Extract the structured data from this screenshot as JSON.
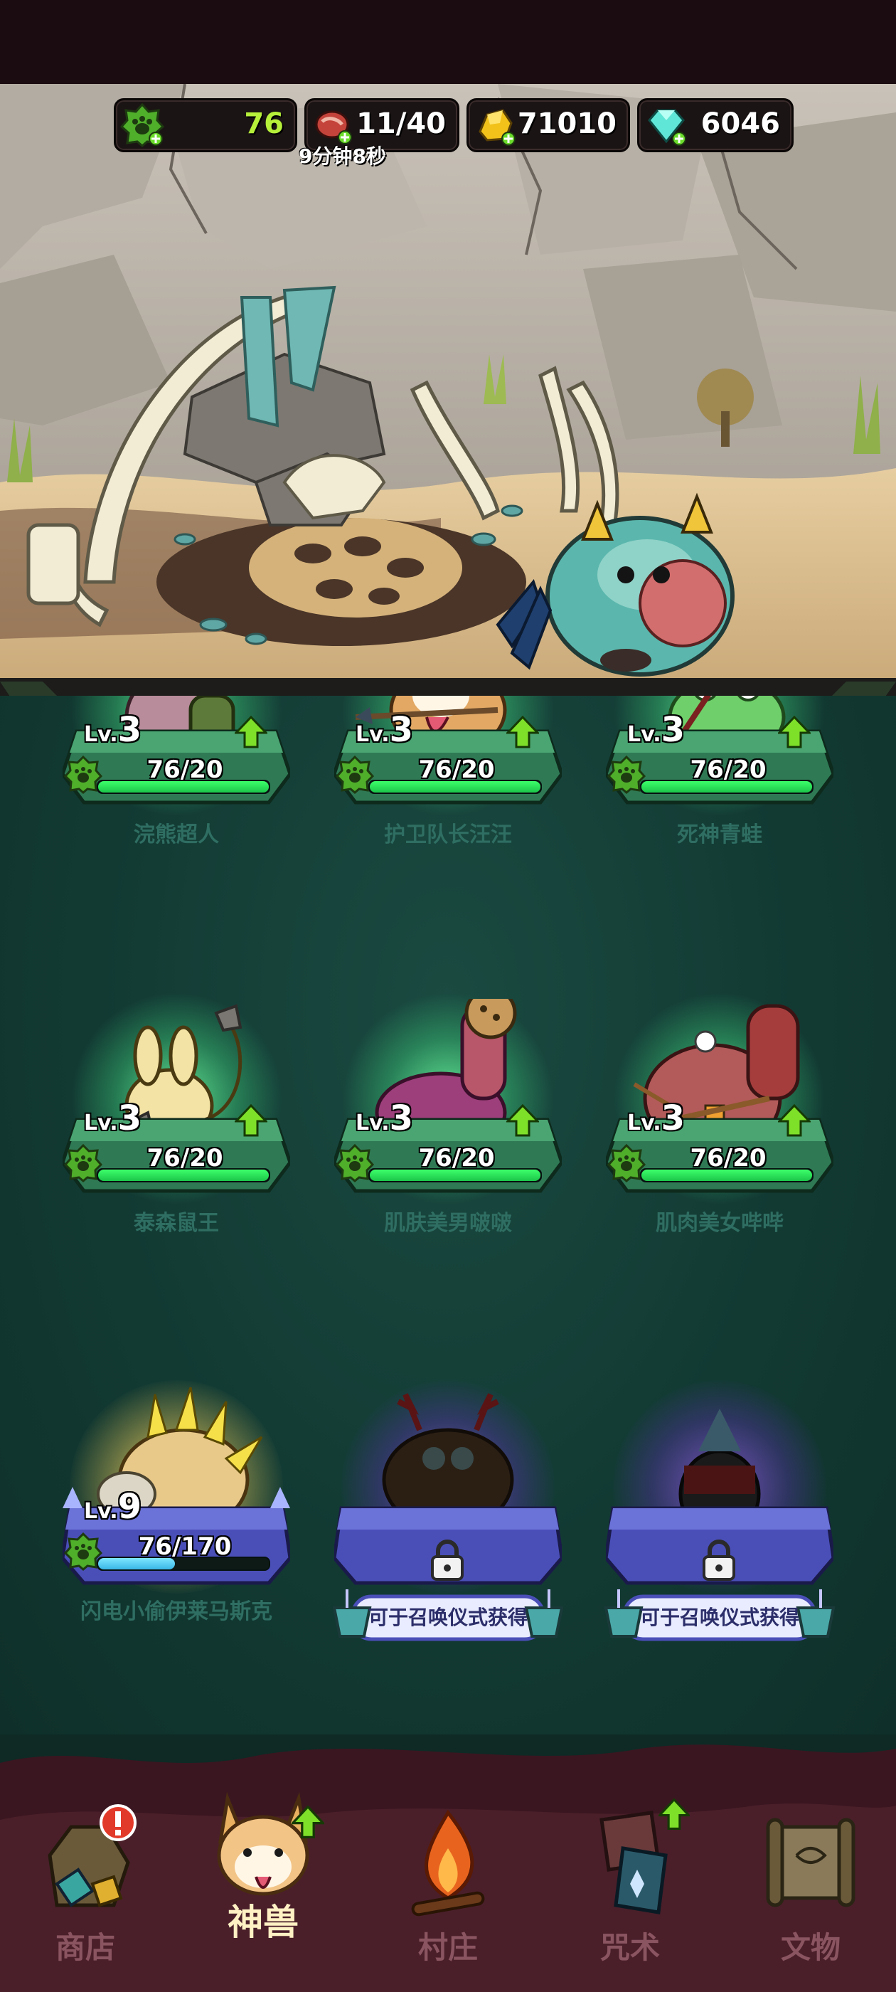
{
  "resources": [
    {
      "name": "beast-points",
      "icon": "green-paw-icon",
      "value": "76",
      "color": "#b6f03a"
    },
    {
      "name": "meat",
      "icon": "meat-icon",
      "value": "11/40",
      "color": "#ffffff"
    },
    {
      "name": "gold",
      "icon": "gold-nugget-icon",
      "value": "71010",
      "color": "#ffffff"
    },
    {
      "name": "gem",
      "icon": "diamond-icon",
      "value": "6046",
      "color": "#ffffff"
    }
  ],
  "meat_timer": "9分钟8秒",
  "beasts": [
    {
      "name": "浣熊超人",
      "level_prefix": "Lv.",
      "level": "3",
      "xp": "76/20",
      "xp_fraction": 1.0,
      "state": "unlocked"
    },
    {
      "name": "护卫队长汪汪",
      "level_prefix": "Lv.",
      "level": "3",
      "xp": "76/20",
      "xp_fraction": 1.0,
      "state": "unlocked"
    },
    {
      "name": "死神青蛙",
      "level_prefix": "Lv.",
      "level": "3",
      "xp": "76/20",
      "xp_fraction": 1.0,
      "state": "unlocked"
    },
    {
      "name": "泰森鼠王",
      "level_prefix": "Lv.",
      "level": "3",
      "xp": "76/20",
      "xp_fraction": 1.0,
      "state": "unlocked"
    },
    {
      "name": "肌肤美男啵啵",
      "level_prefix": "Lv.",
      "level": "3",
      "xp": "76/20",
      "xp_fraction": 1.0,
      "state": "unlocked"
    },
    {
      "name": "肌肉美女哔哔",
      "level_prefix": "Lv.",
      "level": "3",
      "xp": "76/20",
      "xp_fraction": 1.0,
      "state": "unlocked"
    },
    {
      "name": "闪电小偷伊莱马斯克",
      "level_prefix": "Lv.",
      "level": "9",
      "xp": "76/170",
      "xp_fraction": 0.45,
      "state": "unlocked"
    }
  ],
  "locked_beasts": [
    {
      "unlock_text": "可于召唤仪式获得"
    },
    {
      "unlock_text": "可于召唤仪式获得"
    }
  ],
  "nav": [
    {
      "label": "商店",
      "icon": "shop-icon"
    },
    {
      "label": "神兽",
      "icon": "corgi-beast-icon"
    },
    {
      "label": "村庄",
      "icon": "campfire-icon"
    },
    {
      "label": "咒术",
      "icon": "spell-icon"
    },
    {
      "label": "文物",
      "icon": "scroll-icon"
    }
  ],
  "active_nav": "神兽",
  "colors": {
    "accent_green": "#3cff6a",
    "bg": "#123c35",
    "nav_inactive": "#8a5560",
    "nav_active": "#fff1c4"
  }
}
